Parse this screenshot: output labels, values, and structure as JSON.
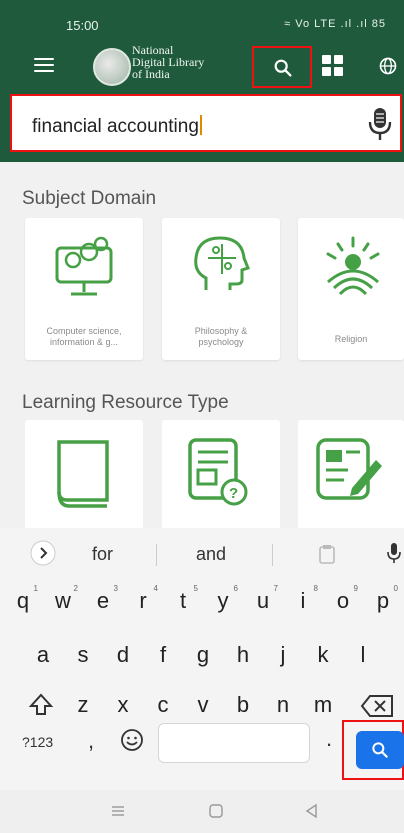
{
  "status_bar": {
    "time": "15:00",
    "icons": "≈ Vo LTE .ıl .ıl 85"
  },
  "app_bar": {
    "logo_text_line1": "National",
    "logo_text_line2": "Digital Library",
    "logo_text_line3": "of India"
  },
  "search": {
    "value": "financial accounting"
  },
  "sections": {
    "subject_title": "Subject Domain",
    "subject_cards": [
      {
        "label_line1": "Computer science,",
        "label_line2": "information & g...",
        "icon": "computer-network-icon"
      },
      {
        "label_line1": "Philosophy &",
        "label_line2": "psychology",
        "icon": "head-puzzle-icon"
      },
      {
        "label_line1": "Religion",
        "label_line2": "",
        "icon": "sun-rays-icon"
      }
    ],
    "resource_title": "Learning Resource Type",
    "resource_cards": [
      {
        "icon": "book-icon"
      },
      {
        "icon": "document-question-icon"
      },
      {
        "icon": "document-edit-icon"
      }
    ]
  },
  "keyboard": {
    "suggestions": [
      "for",
      "and"
    ],
    "row1": [
      {
        "k": "q",
        "n": "1"
      },
      {
        "k": "w",
        "n": "2"
      },
      {
        "k": "e",
        "n": "3"
      },
      {
        "k": "r",
        "n": "4"
      },
      {
        "k": "t",
        "n": "5"
      },
      {
        "k": "y",
        "n": "6"
      },
      {
        "k": "u",
        "n": "7"
      },
      {
        "k": "i",
        "n": "8"
      },
      {
        "k": "o",
        "n": "9"
      },
      {
        "k": "p",
        "n": "0"
      }
    ],
    "row2": [
      "a",
      "s",
      "d",
      "f",
      "g",
      "h",
      "j",
      "k",
      "l"
    ],
    "row3": [
      "z",
      "x",
      "c",
      "v",
      "b",
      "n",
      "m"
    ],
    "symbols_label": "?123",
    "comma_label": ",",
    "period_label": "."
  },
  "colors": {
    "brand_green": "#1f5a3c",
    "accent_green": "#46a046",
    "highlight_red": "#e11111",
    "keyboard_blue": "#1a73e8"
  }
}
